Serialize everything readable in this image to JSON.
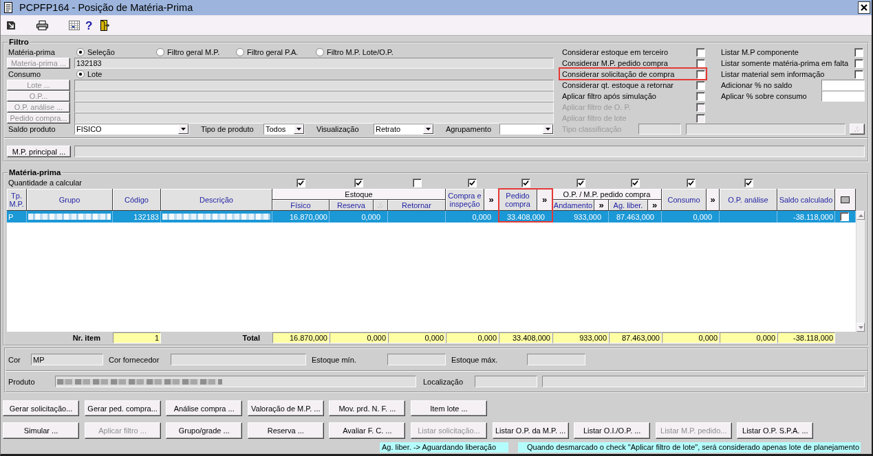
{
  "window": {
    "title": "PCPFP164 - Posição de Matéria-Prima"
  },
  "toolbar": {
    "help": "?"
  },
  "filter": {
    "title": "Filtro",
    "rows": [
      {
        "kind": "radio",
        "label": "Matéria-prima",
        "options": [
          {
            "label": "Seleção",
            "selected": true
          },
          {
            "label": "Filtro geral M.P.",
            "selected": false
          },
          {
            "label": "Filtro geral P.A.",
            "selected": false
          },
          {
            "label": "Filtro M.P. Lote/O.P.",
            "selected": false
          }
        ]
      },
      {
        "kind": "lookup",
        "button": "Materia-prima ...",
        "disabled": true,
        "value": "132183"
      },
      {
        "kind": "radio",
        "label": "Consumo",
        "options": [
          {
            "label": "Lote",
            "selected": true
          }
        ]
      },
      {
        "kind": "lookup",
        "button": "Lote ...",
        "disabled": true
      },
      {
        "kind": "lookup",
        "button": "O.P...",
        "disabled": true
      },
      {
        "kind": "lookup",
        "button": "O.P. análise ...",
        "disabled": true
      },
      {
        "kind": "lookup",
        "button": "Pedido compra...",
        "disabled": true
      }
    ],
    "selects": [
      {
        "label": "Saldo produto",
        "value": "FISICO"
      },
      {
        "label": "Tipo de produto",
        "value": "Todos"
      },
      {
        "label": "Visualização",
        "value": "Retrato"
      },
      {
        "label": "Agrupamento"
      }
    ],
    "options": [
      {
        "label": "Considerar estoque em terceiro",
        "checked": false,
        "disabled": false,
        "highlighted": false
      },
      {
        "label": "Considerar M.P. pedido compra",
        "checked": false,
        "disabled": false,
        "highlighted": false
      },
      {
        "label": "Considerar solicitação de compra",
        "checked": false,
        "disabled": false,
        "highlighted": true
      },
      {
        "label": "Considerar qt. estoque a retornar",
        "checked": false,
        "disabled": false,
        "highlighted": false
      },
      {
        "label": "Aplicar filtro após simulação",
        "checked": false,
        "disabled": false,
        "highlighted": false
      },
      {
        "label": "Aplicar filtro de O. P.",
        "checked": false,
        "disabled": true,
        "highlighted": false
      },
      {
        "label": "Aplicar filtro de lote",
        "checked": false,
        "disabled": true,
        "highlighted": false
      }
    ],
    "extras": [
      {
        "kind": "checkbox",
        "label": "Listar M.P componente",
        "checked": false
      },
      {
        "kind": "checkbox",
        "label": "Listar somente matéria-prima em falta",
        "checked": false
      },
      {
        "kind": "checkbox",
        "label": "Listar material sem informação",
        "checked": false
      },
      {
        "kind": "input",
        "label": "Adicionar % no saldo"
      },
      {
        "kind": "input",
        "label": "Aplicar % sobre consumo"
      }
    ],
    "classification": {
      "label": "Tipo classificação",
      "disabled": true
    },
    "principal": {
      "button": "M.P. principal ...",
      "disabled": false
    }
  },
  "materials": {
    "title": "Matéria-prima",
    "calc_label": "Quantidade a calcular",
    "columns": [
      {
        "kind": "text",
        "label": "Tp. M.P.",
        "grouped": false
      },
      {
        "kind": "text",
        "label": "Grupo",
        "grouped": false
      },
      {
        "kind": "text",
        "label": "Código",
        "grouped": false
      },
      {
        "kind": "text",
        "label": "Descrição",
        "grouped": false
      },
      {
        "kind": "text",
        "label": "Físico",
        "calc": true,
        "grouped": true,
        "group": "Estoque"
      },
      {
        "kind": "text",
        "label": "Reserva",
        "calc": true,
        "grouped": true
      },
      {
        "kind": "icon",
        "grouped": true
      },
      {
        "kind": "text",
        "label": "Retornar",
        "calc": false,
        "grouped": true
      },
      {
        "kind": "text",
        "label": "Compra e inspeção",
        "calc": true,
        "grouped": false
      },
      {
        "kind": "expand",
        "label": "»",
        "grouped": false
      },
      {
        "kind": "text",
        "label": "Pedido compra",
        "calc": true,
        "grouped": false,
        "highlighted": true
      },
      {
        "kind": "expand",
        "label": "»",
        "grouped": false
      },
      {
        "kind": "text",
        "label": "Andamento",
        "calc": true,
        "grouped": true,
        "group": "O.P. / M.P. pedido compra"
      },
      {
        "kind": "expand",
        "label": "»",
        "grouped": true
      },
      {
        "kind": "text",
        "label": "Ag. liber.",
        "calc": true,
        "grouped": true
      },
      {
        "kind": "expand",
        "label": "»",
        "grouped": true
      },
      {
        "kind": "text",
        "label": "Consumo",
        "calc": true,
        "grouped": false
      },
      {
        "kind": "expand",
        "label": "»",
        "grouped": false
      },
      {
        "kind": "text",
        "label": "O.P. análise",
        "calc": true,
        "grouped": false
      },
      {
        "kind": "text",
        "label": "Saldo calculado",
        "grouped": false
      },
      {
        "kind": "select",
        "grouped": false
      }
    ],
    "rows": [
      {
        "selected": true,
        "cells": [
          "P",
          {
            "blurred": true
          },
          "132183",
          {
            "blurred": true
          },
          "16.870,000",
          "0,000",
          "",
          "",
          "0,000",
          "",
          "33.408,000",
          "",
          "933,000",
          "",
          "87.463,000",
          "",
          "0,000",
          "",
          "",
          "-38.118,000",
          {
            "kind": "checkbox",
            "checked": false
          }
        ]
      }
    ],
    "totals": {
      "cells": [
        "",
        {
          "kind": "label",
          "text": "Nr. item"
        },
        {
          "kind": "field",
          "text": "1"
        },
        {
          "kind": "label",
          "text": "Total"
        },
        {
          "kind": "field",
          "text": "16.870,000"
        },
        {
          "kind": "field",
          "text": "0,000"
        },
        "",
        {
          "kind": "field",
          "text": "0,000"
        },
        {
          "kind": "field",
          "text": "0,000"
        },
        "",
        {
          "kind": "field",
          "text": "33.408,000"
        },
        "",
        {
          "kind": "field",
          "text": "933,000"
        },
        "",
        {
          "kind": "field",
          "text": "87.463,000"
        },
        "",
        {
          "kind": "field",
          "text": "0,000"
        },
        "",
        {
          "kind": "field",
          "text": "0,000"
        },
        {
          "kind": "field",
          "text": "-38.118,000"
        },
        ""
      ]
    }
  },
  "details": {
    "fields": [
      {
        "label": "Cor",
        "value": "MP"
      },
      {
        "label": "Cor fornecedor"
      },
      {
        "label": "Estoque mín."
      },
      {
        "label": "Estoque máx."
      }
    ]
  },
  "product": {
    "label": "Produto",
    "blurred": true,
    "location_label": "Localização"
  },
  "action_rows": [
    {
      "buttons": [
        {
          "label": "Gerar solicitação...",
          "disabled": false
        },
        {
          "label": "Gerar ped. compra...",
          "disabled": false
        },
        {
          "label": "Análise compra ...",
          "disabled": false
        },
        {
          "label": "Valoração de M.P. ...",
          "disabled": false
        },
        {
          "label": "Mov. prd. N. F. ...",
          "disabled": false
        },
        {
          "label": "Item lote ...",
          "disabled": false
        }
      ]
    },
    {
      "buttons": [
        {
          "label": "Simular ...",
          "disabled": false
        },
        {
          "label": "Aplicar filtro ...",
          "disabled": true
        },
        {
          "label": "Grupo/grade ...",
          "disabled": false
        },
        {
          "label": "Reserva ...",
          "disabled": false
        },
        {
          "label": "Avaliar F. C. ...",
          "disabled": false
        },
        {
          "label": "Listar solicitação...",
          "disabled": true
        },
        {
          "label": "Listar O.P. da M.P. ...",
          "disabled": false
        },
        {
          "label": "Listar O.I./O.P. ...",
          "disabled": false
        },
        {
          "label": "Listar M.P. pedido...",
          "disabled": true
        },
        {
          "label": "Listar O.P. S.P.A. ...",
          "disabled": false
        }
      ]
    }
  ],
  "status_bar": [
    "Ag. liber. -> Aguardando liberação",
    "Quando desmarcado o check \"Aplicar filtro de lote\", será considerado apenas lote de planejamento"
  ]
}
